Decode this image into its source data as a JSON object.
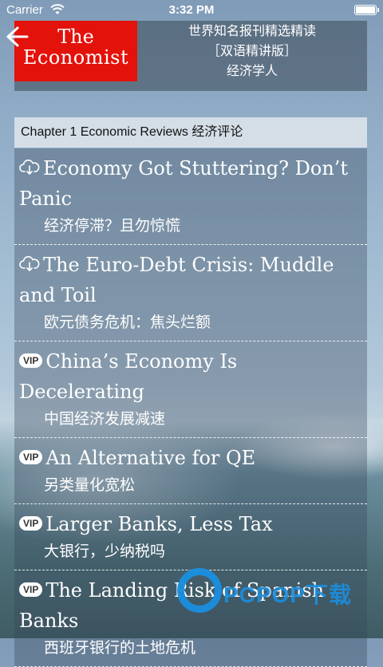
{
  "status_bar": {
    "carrier": "Carrier",
    "time": "3:32 PM",
    "battery_level": 1.0
  },
  "header": {
    "back_icon": "back-arrow-icon",
    "logo": {
      "line1": "The",
      "line2": "Economist",
      "color": "#e3120b"
    },
    "subtitle_line1": "世界知名报刊精选精读",
    "subtitle_line2": "［双语精讲版］",
    "subtitle_line3": "经济学人"
  },
  "chapter": {
    "label": "Chapter 1 Economic Reviews 经济评论"
  },
  "articles": [
    {
      "icon": "cloud-download-icon",
      "title": "Economy Got Stuttering? Don’t Panic",
      "subtitle": "经济停滞？且勿惊慌"
    },
    {
      "icon": "cloud-download-icon",
      "title": "The Euro-Debt Crisis: Muddle and Toil",
      "subtitle": "欧元债务危机：焦头烂额"
    },
    {
      "icon": "vip-badge",
      "badge": "VIP",
      "title": "China’s Economy Is Decelerating",
      "subtitle": "中国经济发展减速"
    },
    {
      "icon": "vip-badge",
      "badge": "VIP",
      "title": "An Alternative for QE",
      "subtitle": "另类量化宽松"
    },
    {
      "icon": "vip-badge",
      "badge": "VIP",
      "title": "Larger Banks, Less Tax",
      "subtitle": "大银行，少纳税吗"
    },
    {
      "icon": "vip-badge",
      "badge": "VIP",
      "title": "The Landing Risk of Spanish Banks",
      "subtitle": "西班牙银行的土地危机"
    }
  ],
  "watermark": {
    "text": "PCPOP下载",
    "color": "#1a8fe0"
  }
}
